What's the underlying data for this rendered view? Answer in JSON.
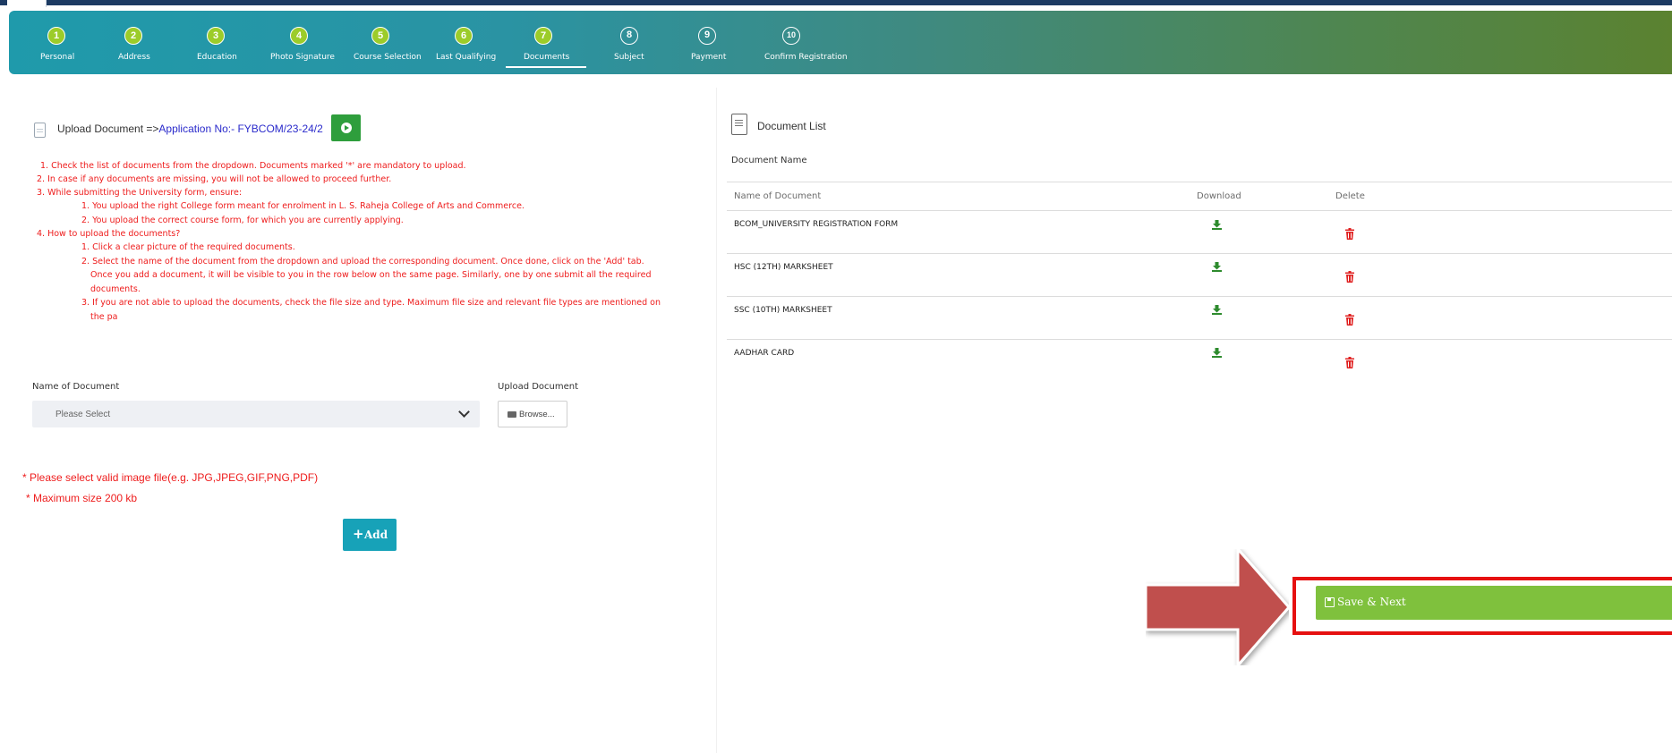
{
  "colors": {
    "header_gradient_start": "#1f9aab",
    "header_gradient_end": "#5b8230",
    "step_done": "#9ccc2a",
    "instruction_red": "#ee1c1c",
    "add_button": "#17a2b8",
    "save_button": "#7fc13d",
    "highlight_red": "#e61010",
    "arrow_fill": "#c0504d"
  },
  "steps": [
    {
      "num": "1",
      "label": "Personal",
      "status": "done"
    },
    {
      "num": "2",
      "label": "Address",
      "status": "done"
    },
    {
      "num": "3",
      "label": "Education",
      "status": "done"
    },
    {
      "num": "4",
      "label": "Photo Signature",
      "status": "done"
    },
    {
      "num": "5",
      "label": "Course Selection",
      "status": "done"
    },
    {
      "num": "6",
      "label": "Last Qualifying",
      "status": "done"
    },
    {
      "num": "7",
      "label": "Documents",
      "status": "active"
    },
    {
      "num": "8",
      "label": "Subject",
      "status": "todo"
    },
    {
      "num": "9",
      "label": "Payment",
      "status": "todo"
    },
    {
      "num": "10",
      "label": "Confirm Registration",
      "status": "todo"
    }
  ],
  "upload": {
    "title_prefix": "Upload Document =>",
    "application_no": "Application No:- FYBCOM/23-24/2",
    "instructions": [
      "1. Check the list of documents from the dropdown. Documents marked '*' are mandatory to upload.",
      "2. In case if any documents are missing, you will not be allowed to proceed further.",
      "3. While submitting the University form, ensure:",
      "1. You upload the right College form meant for enrolment in L. S. Raheja College of Arts and Commerce.",
      "2. You upload the correct course form, for which you are currently applying.",
      "4. How to upload the documents?",
      "1. Click a clear picture of the required documents.",
      "2. Select the name of the document from the dropdown and upload the corresponding document. Once done, click on the 'Add' tab.",
      "Once you add a document, it will be visible to you in the row below on the same page. Similarly, one by one submit all the required",
      "documents.",
      "3. If you are not able to upload the documents, check the file size and type. Maximum file size and relevant file types are mentioned on",
      "the pa"
    ],
    "name_label": "Name of Document",
    "upload_label": "Upload Document",
    "select_placeholder": "Please Select",
    "browse_label": "Browse...",
    "note_types": "* Please select valid image file(e.g. JPG,JPEG,GIF,PNG,PDF)",
    "note_size": "* Maximum size 200 kb",
    "add_label": "Add"
  },
  "doc_list": {
    "title": "Document List",
    "section_label": "Document Name",
    "headers": {
      "name": "Name of Document",
      "download": "Download",
      "delete": "Delete"
    },
    "rows": [
      {
        "name": "BCOM_UNIVERSITY REGISTRATION FORM",
        "download_icon": "download-icon",
        "delete_icon": "trash-icon"
      },
      {
        "name": "HSC (12TH) MARKSHEET",
        "download_icon": "download-icon",
        "delete_icon": "trash-icon"
      },
      {
        "name": "SSC (10TH) MARKSHEET",
        "download_icon": "download-icon",
        "delete_icon": "trash-icon"
      },
      {
        "name": "AADHAR CARD",
        "download_icon": "download-icon",
        "delete_icon": "trash-icon"
      }
    ]
  },
  "save_label": "Save & Next"
}
